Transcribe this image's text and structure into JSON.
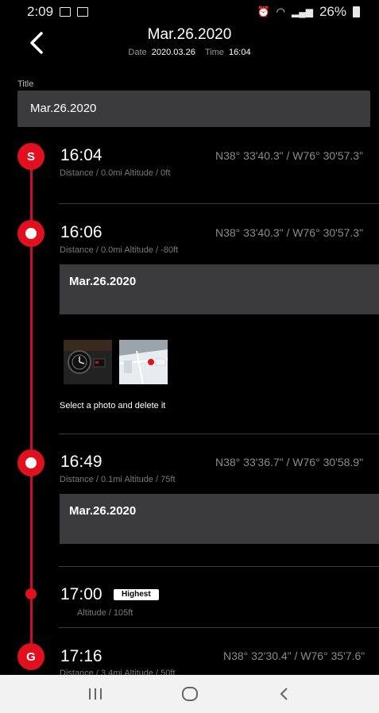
{
  "status_bar": {
    "time": "2:09",
    "battery": "26%"
  },
  "header": {
    "title": "Mar.26.2020",
    "date_label": "Date",
    "date_value": "2020.03.26",
    "time_label": "Time",
    "time_value": "16:04"
  },
  "title_field": {
    "label": "Title",
    "value": "Mar.26.2020"
  },
  "entries": [
    {
      "marker": "S",
      "time": "16:04",
      "stats": "Distance / 0.0mi     Altitude / 0ft",
      "coord": "N38° 33'40.3\" / W76° 30'57.3\""
    },
    {
      "marker": "",
      "time": "16:06",
      "stats": "Distance / 0.0mi     Altitude / -80ft",
      "coord": "N38° 33'40.3\" / W76° 30'57.3\"",
      "memo": "Mar.26.2020"
    },
    {
      "marker": "",
      "time": "16:49",
      "stats": "Distance / 0.1mi     Altitude / 75ft",
      "coord": "N38° 33'36.7\" / W76° 30'58.9\"",
      "memo": "Mar.26.2020"
    },
    {
      "marker": "",
      "time": "17:00",
      "badge": "Highest",
      "stats": "Altitude / 105ft"
    },
    {
      "marker": "G",
      "time": "17:16",
      "stats": "Distance / 3.4mi     Altitude / 50ft",
      "coord": "N38° 32'30.4\" / W76° 35'7.6\""
    }
  ],
  "photos_hint": "Select a photo and delete it",
  "colors": {
    "accent": "#e0101f",
    "line": "#c8102e",
    "panel": "#3b3b3d",
    "background": "#000000"
  }
}
